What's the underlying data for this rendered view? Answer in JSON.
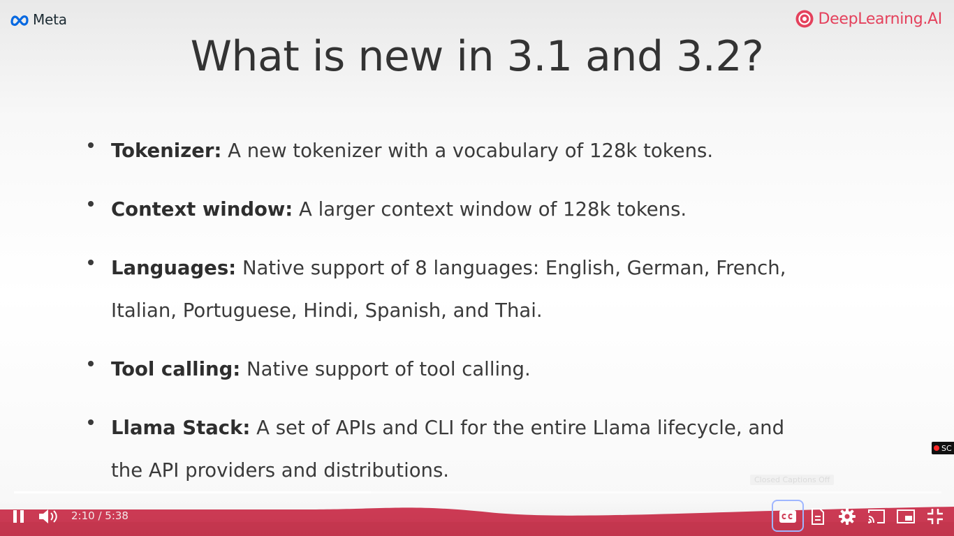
{
  "branding": {
    "meta_logo_text": "Meta",
    "deeplearning_logo_text": "DeepLearning.AI",
    "accent_color": "#e4415c"
  },
  "slide": {
    "title": "What is new in 3.1 and 3.2?",
    "bullets": [
      {
        "term": "Tokenizer:",
        "text": "A new tokenizer with a vocabulary of 128k tokens.",
        "line2": ""
      },
      {
        "term": "Context window:",
        "text": "A larger context window of 128k tokens.",
        "line2": ""
      },
      {
        "term": "Languages:",
        "text": "Native support of 8 languages: English, German, French,",
        "line2": "Italian, Portuguese, Hindi, Spanish, and Thai."
      },
      {
        "term": "Tool calling:",
        "text": "Native support of tool calling.",
        "line2": ""
      },
      {
        "term": "Llama Stack:",
        "text": "A set of APIs and CLI for the entire Llama lifecycle, and",
        "line2": "the API providers and distributions."
      }
    ]
  },
  "player": {
    "current_time": "2:10",
    "separator": " / ",
    "duration": "5:38",
    "progress_fraction": 0.385,
    "captions_tooltip": "Closed Captions Off",
    "rec_label": "SC",
    "icons": {
      "play_pause": "pause-icon",
      "volume": "volume-icon",
      "captions": "closed-captions-icon",
      "transcript": "document-icon",
      "settings": "gear-icon",
      "cast": "cast-icon",
      "miniplayer": "miniplayer-icon",
      "fullscreen": "exit-fullscreen-icon"
    }
  }
}
